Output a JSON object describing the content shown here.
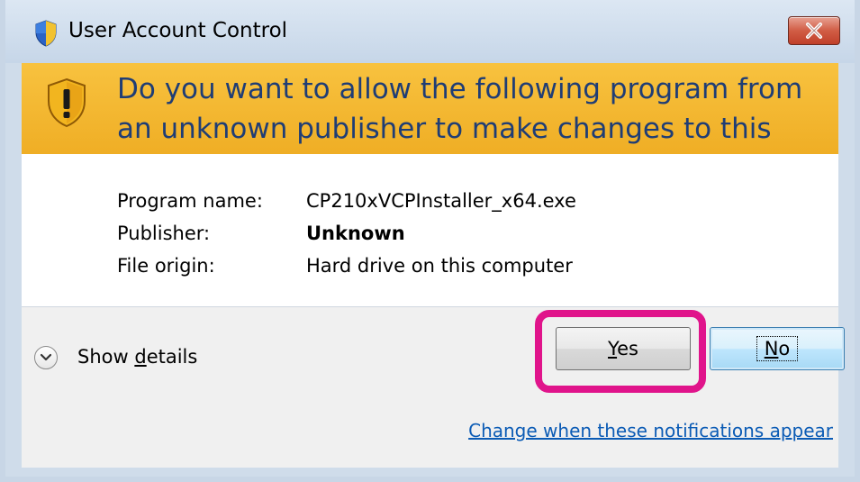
{
  "window": {
    "title": "User Account Control",
    "close_label": "Close"
  },
  "banner": {
    "question": "Do you want to allow the following program from an unknown publisher to make changes to this computer?"
  },
  "info": {
    "rows": [
      {
        "label": "Program name:",
        "value": "CP210xVCPInstaller_x64.exe"
      },
      {
        "label": "Publisher:",
        "value": "Unknown"
      },
      {
        "label": "File origin:",
        "value": "Hard drive on this computer"
      }
    ]
  },
  "footer": {
    "details_label_pre": "Show ",
    "details_label_mnemonic": "d",
    "details_label_post": "etails",
    "yes_mnemonic": "Y",
    "yes_rest": "es",
    "no_mnemonic": "N",
    "no_rest": "o",
    "link": "Change when these notifications appear"
  },
  "colors": {
    "banner": "#f0b02c",
    "question_text": "#1f3d75",
    "highlight": "#e0148b",
    "link": "#0b5bb5"
  },
  "icons": [
    "uac-shield-icon",
    "warning-shield-icon",
    "close-icon",
    "chevron-down-icon"
  ]
}
